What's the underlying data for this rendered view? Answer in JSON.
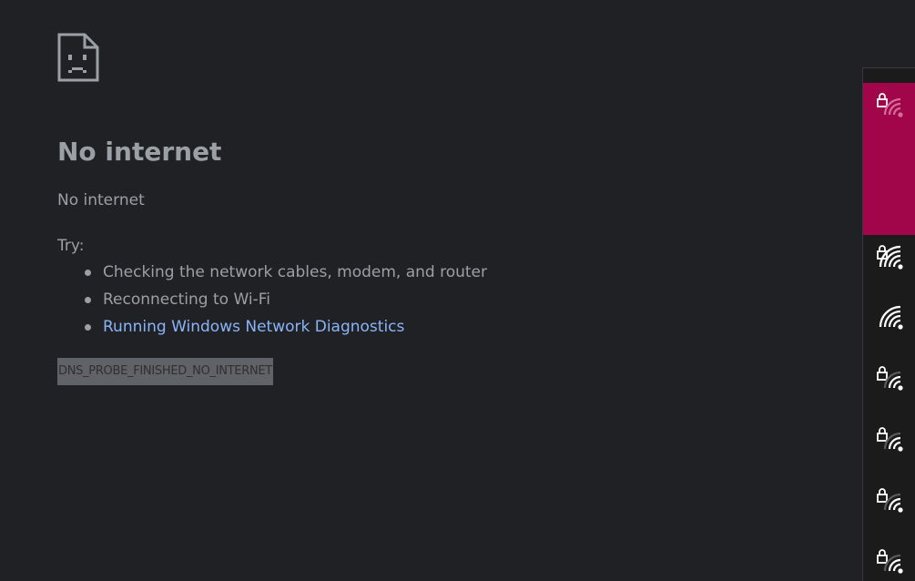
{
  "page": {
    "title": "No internet",
    "subtitle": "No internet",
    "try_label": "Try:",
    "suggestions": [
      {
        "text": "Checking the network cables, modem, and router",
        "is_link": false
      },
      {
        "text": "Reconnecting to Wi-Fi",
        "is_link": false
      },
      {
        "text": "Running Windows Network Diagnostics",
        "is_link": true
      }
    ],
    "error_code": "DNS_PROBE_FINISHED_NO_INTERNET"
  },
  "colors": {
    "background": "#202124",
    "text": "#9aa0a6",
    "link": "#8ab4f8",
    "selected_network": "#a1064a",
    "panel_background": "#1b1b1b"
  },
  "icons": {
    "sad_page": "sad-page-icon",
    "wifi": "wifi-icon",
    "lock": "lock-icon"
  },
  "wifi_networks": [
    {
      "secured": true,
      "selected": true,
      "signal": 0
    },
    {
      "secured": true,
      "selected": false,
      "signal": 4
    },
    {
      "secured": false,
      "selected": false,
      "signal": 4
    },
    {
      "secured": true,
      "selected": false,
      "signal": 3
    },
    {
      "secured": true,
      "selected": false,
      "signal": 3
    },
    {
      "secured": true,
      "selected": false,
      "signal": 3
    },
    {
      "secured": true,
      "selected": false,
      "signal": 3
    }
  ]
}
